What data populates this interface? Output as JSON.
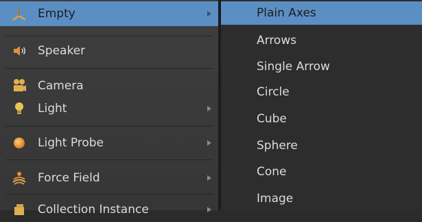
{
  "main_menu": {
    "items": [
      {
        "label": "Empty",
        "icon": "empty-axes-icon",
        "has_submenu": true,
        "active": true
      },
      {
        "label": "Speaker",
        "icon": "speaker-icon",
        "has_submenu": false
      },
      {
        "label": "Camera",
        "icon": "camera-icon",
        "has_submenu": false
      },
      {
        "label": "Light",
        "icon": "light-bulb-icon",
        "has_submenu": true
      },
      {
        "label": "Light Probe",
        "icon": "light-probe-icon",
        "has_submenu": true
      },
      {
        "label": "Force Field",
        "icon": "force-field-icon",
        "has_submenu": true
      },
      {
        "label": "Collection Instance",
        "icon": "collection-icon",
        "has_submenu": true
      }
    ]
  },
  "submenu": {
    "items": [
      {
        "label": "Plain Axes",
        "active": true
      },
      {
        "label": "Arrows"
      },
      {
        "label": "Single Arrow"
      },
      {
        "label": "Circle"
      },
      {
        "label": "Cube"
      },
      {
        "label": "Sphere"
      },
      {
        "label": "Cone"
      },
      {
        "label": "Image"
      }
    ]
  },
  "colors": {
    "highlight": "#5b8fc4",
    "menu_bg": "#3a3a3a",
    "submenu_bg": "#2d2d2d",
    "text": "#dcdcdc",
    "icon_orange": "#e0913a"
  }
}
